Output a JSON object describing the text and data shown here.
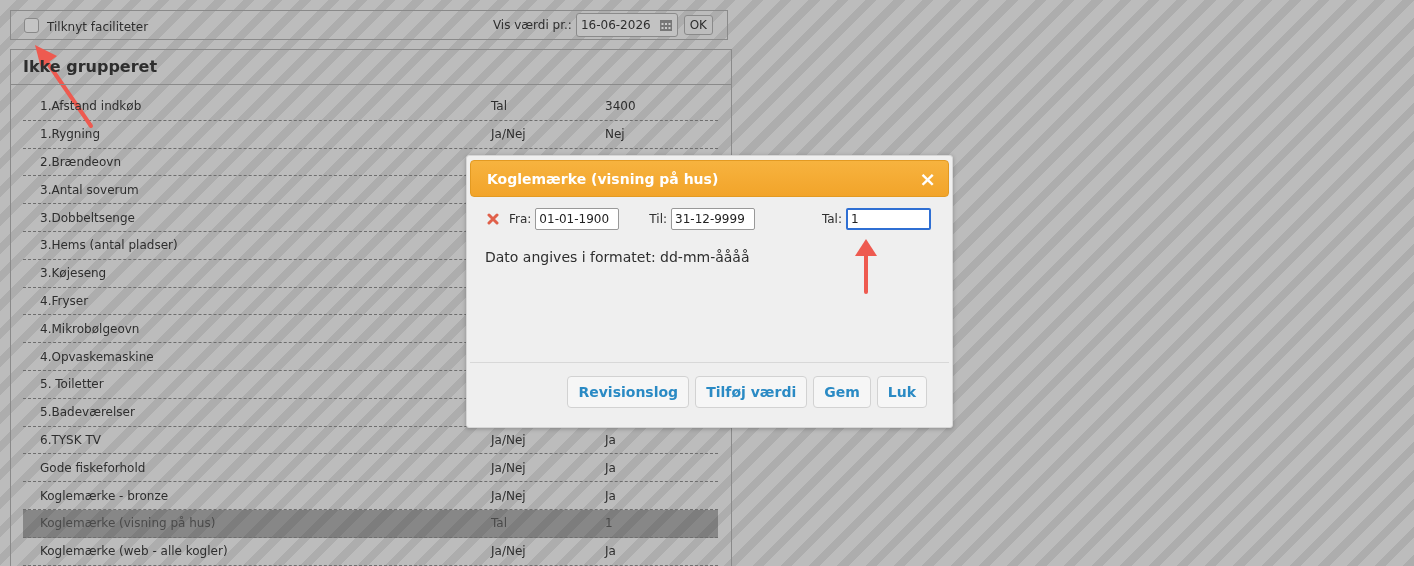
{
  "toolbar": {
    "checkbox": {
      "label": "Tilknyt faciliteter",
      "checked": false
    },
    "date_label": "Vis værdi pr.:",
    "date_value": "16-06-2026",
    "ok_button": "OK"
  },
  "group": {
    "title": "Ikke grupperet",
    "rows": [
      {
        "name": "1.Afstand indkøb",
        "type": "Tal",
        "value": "3400",
        "selected": false
      },
      {
        "name": "1.Rygning",
        "type": "Ja/Nej",
        "value": "Nej",
        "selected": false
      },
      {
        "name": "2.Brændeovn",
        "selected": false
      },
      {
        "name": "3.Antal soverum",
        "selected": false
      },
      {
        "name": "3.Dobbeltsenge",
        "selected": false
      },
      {
        "name": "3.Hems (antal pladser)",
        "selected": false
      },
      {
        "name": "3.Køjeseng",
        "selected": false
      },
      {
        "name": "4.Fryser",
        "selected": false
      },
      {
        "name": "4.Mikrobølgeovn",
        "selected": false
      },
      {
        "name": "4.Opvaskemaskine",
        "selected": false
      },
      {
        "name": "5. Toiletter",
        "selected": false
      },
      {
        "name": "5.Badeværelser",
        "selected": false
      },
      {
        "name": "6.TYSK TV",
        "type": "Ja/Nej",
        "value": "Ja",
        "selected": false
      },
      {
        "name": "Gode fiskeforhold",
        "type": "Ja/Nej",
        "value": "Ja",
        "selected": false
      },
      {
        "name": "Koglemærke - bronze",
        "type": "Ja/Nej",
        "value": "Ja",
        "selected": false
      },
      {
        "name": "Koglemærke (visning på hus)",
        "type": "Tal",
        "value": "1",
        "selected": true
      },
      {
        "name": "Koglemærke (web - alle kogler)",
        "type": "Ja/Nej",
        "value": "Ja",
        "selected": false
      }
    ]
  },
  "dialog": {
    "title": "Koglemærke (visning på hus)",
    "close": "×",
    "from_label": "Fra:",
    "from_value": "01-01-1900",
    "to_label": "Til:",
    "to_value": "31-12-9999",
    "number_label": "Tal:",
    "number_value": "1",
    "hint": "Dato angives i formatet: dd-mm-åååå",
    "buttons": [
      "Revisionslog",
      "Tilføj værdi",
      "Gem",
      "Luk"
    ]
  }
}
